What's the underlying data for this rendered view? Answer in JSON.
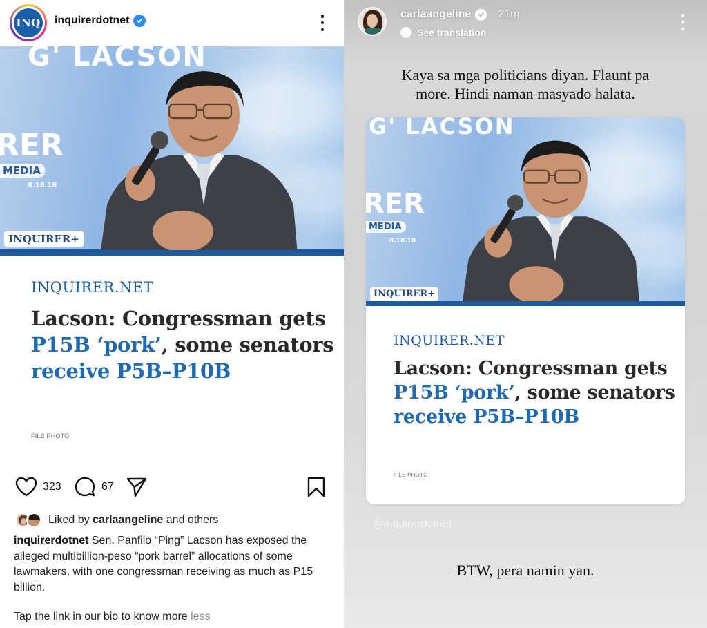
{
  "post": {
    "avatar_text": "INQ",
    "username": "inquirerdotnet",
    "photo_wall_top": "G' LACSON",
    "photo_wall_left": "RER",
    "photo_media": "MEDIA",
    "photo_date": "8.18.18",
    "photo_sign": "INQUIRER+",
    "brand": "INQUIRER.NET",
    "headline_line1": "Lacson: Congressman gets",
    "headline_line2_blue": "P15B ‘pork’",
    "headline_line2_rest": ", some senators",
    "headline_line3_blue": "receive P5B–P10B",
    "file_photo": "FILE PHOTO",
    "likes": "323",
    "comments": "67",
    "liked_by_prefix": "Liked by ",
    "liked_by_user": "carlaangeline",
    "liked_by_suffix": " and others",
    "caption_user": "inquirerdotnet",
    "caption_text": " Sen. Panfilo “Ping” Lacson has exposed the alleged multibillion-peso “pork barrel” allocations of some lawmakers, with one congressman receiving as much as P15 billion.",
    "tap_text": "Tap the link in our bio to know more ",
    "less": "less"
  },
  "story": {
    "username": "carlaangeline",
    "time": "21m",
    "see_translation": "See translation",
    "text_top_line1": "Kaya sa mga politicians diyan. Flaunt pa",
    "text_top_line2": "more. Hindi naman masyado halata.",
    "watermark": "@inquirerdotnet",
    "text_bottom": "BTW, pera namin yan."
  },
  "colors": {
    "brand_blue": "#1c5aa0",
    "headline_blue": "#1e6ab0",
    "verified_blue": "#2e8cf0"
  }
}
